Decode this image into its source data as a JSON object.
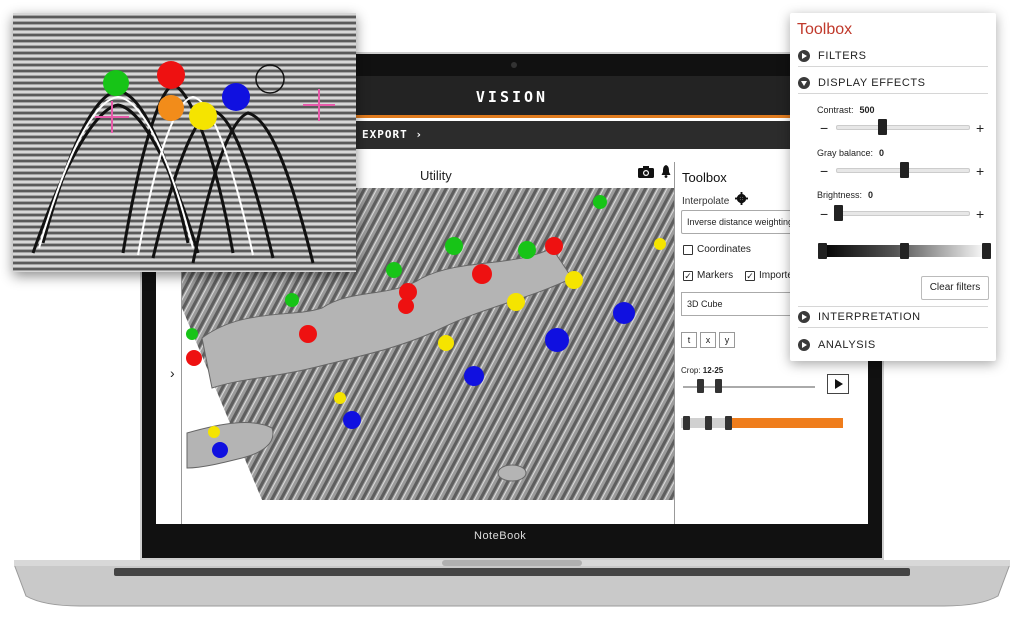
{
  "app": {
    "title": "VISION",
    "export_label": "EXPORT"
  },
  "viewer": {
    "title": "Utility"
  },
  "laptop": {
    "brand": "NoteBook"
  },
  "side_panel": {
    "title": "Toolbox",
    "interpolate_label": "Interpolate",
    "interpolation_method": "Inverse distance weighting",
    "coordinates_label": "Coordinates",
    "coordinates_checked": false,
    "markers_label": "Markers",
    "markers_checked": true,
    "imported_label": "Imported",
    "imported_checked": true,
    "view_mode": "3D Cube",
    "axis_buttons": [
      "t",
      "x",
      "y"
    ],
    "crop_label": "Crop:",
    "crop_value": "12-25"
  },
  "toolbox_card": {
    "title": "Toolbox",
    "sections": {
      "filters": "FILTERS",
      "display_effects": "DISPLAY EFFECTS",
      "interpretation": "INTERPRETATION",
      "analysis": "ANALYSIS"
    },
    "contrast": {
      "label": "Contrast:",
      "value": "500"
    },
    "gray_balance": {
      "label": "Gray balance:",
      "value": "0"
    },
    "brightness": {
      "label": "Brightness:",
      "value": "0"
    },
    "minus_symbol": "−",
    "plus_symbol": "+",
    "clear_label": "Clear filters"
  },
  "colors": {
    "accent_orange": "#ef7d1c",
    "title_red": "#c0392b",
    "marker_green": "#17c417",
    "marker_red": "#ee1111",
    "marker_orange": "#f28c1a",
    "marker_yellow": "#f5e400",
    "marker_blue": "#1010e0"
  },
  "icons": {
    "camera": "camera-icon",
    "bell": "bell-icon",
    "gear": "gear-icon",
    "play": "play-icon",
    "chevron": "chevron-right-icon"
  }
}
